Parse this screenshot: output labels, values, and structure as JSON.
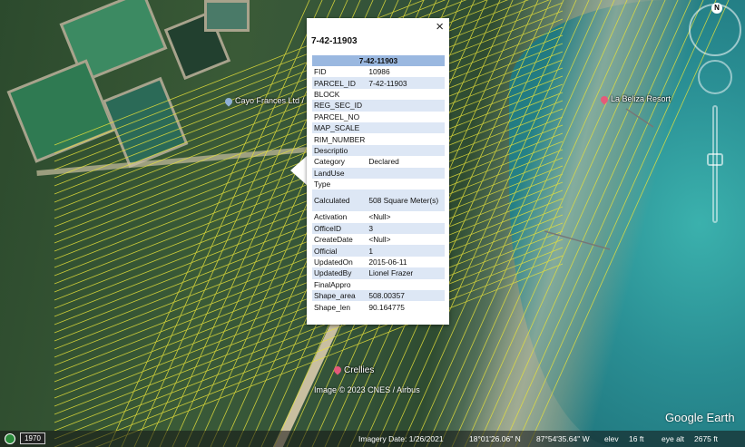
{
  "popup": {
    "title": "7-42-11903",
    "close_glyph": "×",
    "table_header": "7-42-11903",
    "rows": [
      {
        "key": "FID",
        "value": "10986"
      },
      {
        "key": "PARCEL_ID",
        "value": "7-42-11903"
      },
      {
        "key": "BLOCK",
        "value": ""
      },
      {
        "key": "REG_SEC_ID",
        "value": ""
      },
      {
        "key": "PARCEL_NO",
        "value": ""
      },
      {
        "key": "MAP_SCALE",
        "value": ""
      },
      {
        "key": "RIM_NUMBER",
        "value": ""
      },
      {
        "key": "Descriptio",
        "value": ""
      },
      {
        "key": "Category",
        "value": "Declared"
      },
      {
        "key": "LandUse",
        "value": ""
      },
      {
        "key": "Type",
        "value": ""
      },
      {
        "key": "Calculated",
        "value": "508 Square Meter(s)"
      },
      {
        "key": "Activation",
        "value": "<Null>"
      },
      {
        "key": "OfficeID",
        "value": "3"
      },
      {
        "key": "CreateDate",
        "value": "<Null>"
      },
      {
        "key": "Official",
        "value": "1"
      },
      {
        "key": "UpdatedOn",
        "value": "2015-06-11"
      },
      {
        "key": "UpdatedBy",
        "value": "Lionel Frazer"
      },
      {
        "key": "FinalAppro",
        "value": ""
      },
      {
        "key": "Shape_area",
        "value": "508.00357"
      },
      {
        "key": "Shape_len",
        "value": "90.164775"
      }
    ]
  },
  "places": {
    "cayo": "Cayo Frances Ltd / ...",
    "resort": "La Beliza Resort",
    "crellies": "Crellies"
  },
  "compass": {
    "north": "N"
  },
  "watermark": "Image © 2023 CNES / Airbus",
  "brand": "Google Earth",
  "status": {
    "year": "1970",
    "imagery_date": "Imagery Date: 1/26/2021",
    "lat": "18°01'26.06\" N",
    "lon": "87°54'35.64\" W",
    "elev_label": "elev",
    "elev": "16 ft",
    "eye_alt_label": "eye alt",
    "eye_alt": "2675 ft"
  },
  "icons": {
    "historical": "clock-icon",
    "pin_place": "place-pin-icon",
    "pin_resort": "resort-pin-icon"
  },
  "colors": {
    "table_header": "#9ab8e0",
    "row_alt": "#dde7f5",
    "parcel_line": "#e7e23a"
  }
}
